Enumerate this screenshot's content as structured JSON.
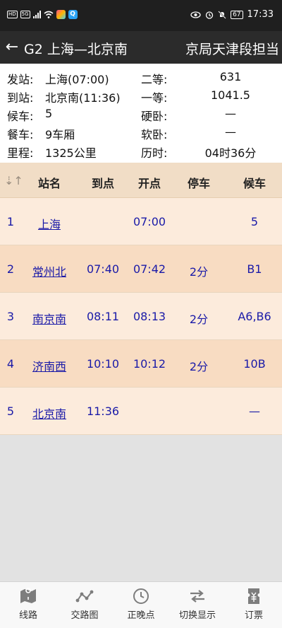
{
  "status_bar": {
    "network_badges": [
      "HD",
      "5G"
    ],
    "battery": "67",
    "time": "17:33"
  },
  "header": {
    "back_icon": "←",
    "title": "G2 上海—北京南",
    "subtitle": "京局天津段担当"
  },
  "info": {
    "rows": [
      {
        "label": "发站:",
        "value": "上海(07:00)",
        "label2": "二等:",
        "value2": "631"
      },
      {
        "label": "到站:",
        "value": "北京南(11:36)",
        "label2": "一等:",
        "value2": "1041.5"
      },
      {
        "label": "候车:",
        "value": "5",
        "label2": "硬卧:",
        "value2": "—"
      },
      {
        "label": "餐车:",
        "value": "9车厢",
        "label2": "软卧:",
        "value2": "—"
      },
      {
        "label": "里程:",
        "value": "1325公里",
        "label2": "历时:",
        "value2": "04时36分"
      }
    ]
  },
  "table": {
    "sort_icon": "⇣↑",
    "headers": [
      "站名",
      "到点",
      "开点",
      "停车",
      "候车"
    ],
    "rows": [
      {
        "no": "1",
        "station": "上海",
        "arrive": "",
        "depart": "07:00",
        "stop": "",
        "gate": "5"
      },
      {
        "no": "2",
        "station": "常州北",
        "arrive": "07:40",
        "depart": "07:42",
        "stop": "2分",
        "gate": "B1"
      },
      {
        "no": "3",
        "station": "南京南",
        "arrive": "08:11",
        "depart": "08:13",
        "stop": "2分",
        "gate": "A6,B6"
      },
      {
        "no": "4",
        "station": "济南西",
        "arrive": "10:10",
        "depart": "10:12",
        "stop": "2分",
        "gate": "10B"
      },
      {
        "no": "5",
        "station": "北京南",
        "arrive": "11:36",
        "depart": "",
        "stop": "",
        "gate": "—"
      }
    ]
  },
  "bottom_nav": [
    {
      "label": "线路",
      "icon": "map-route-icon"
    },
    {
      "label": "交路图",
      "icon": "route-graph-icon"
    },
    {
      "label": "正晚点",
      "icon": "clock-icon"
    },
    {
      "label": "切换显示",
      "icon": "switch-arrows-icon"
    },
    {
      "label": "订票",
      "icon": "ticket-icon"
    }
  ]
}
